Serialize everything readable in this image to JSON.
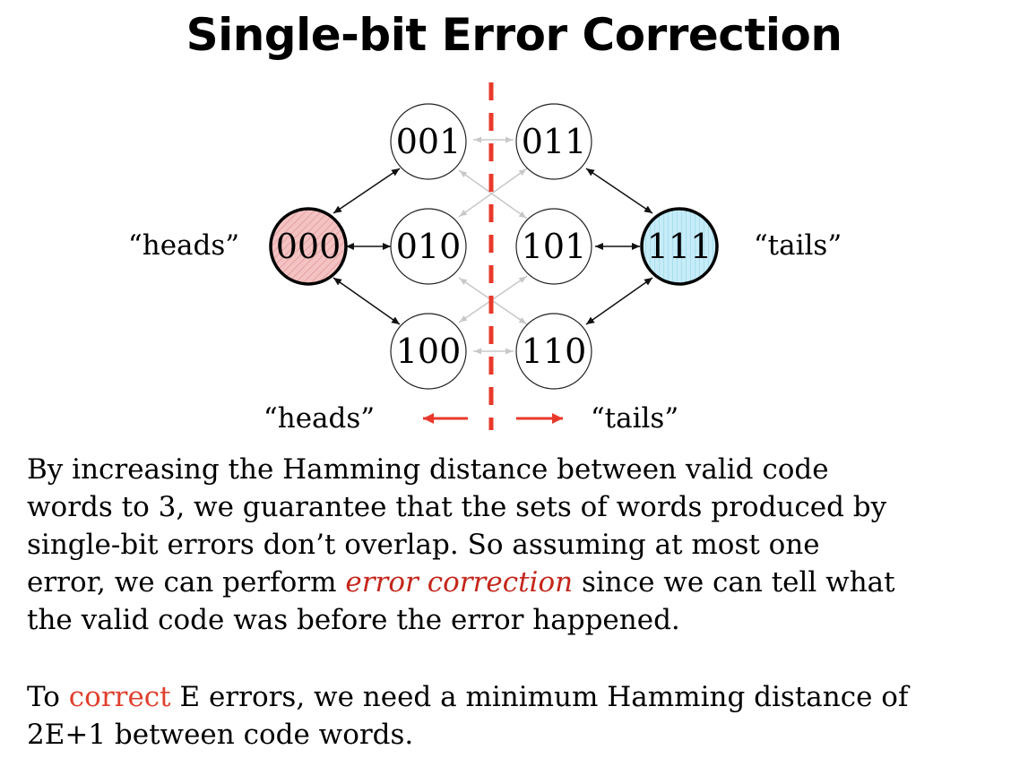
{
  "title": "Single-bit Error Correction",
  "nodes": [
    {
      "id": "n000",
      "label": "000",
      "style": "valid-heads"
    },
    {
      "id": "n001",
      "label": "001",
      "style": "normal"
    },
    {
      "id": "n010",
      "label": "010",
      "style": "normal"
    },
    {
      "id": "n100",
      "label": "100",
      "style": "normal"
    },
    {
      "id": "n011",
      "label": "011",
      "style": "normal"
    },
    {
      "id": "n101",
      "label": "101",
      "style": "normal"
    },
    {
      "id": "n110",
      "label": "110",
      "style": "normal"
    },
    {
      "id": "n111",
      "label": "111",
      "style": "valid-tails"
    }
  ],
  "labels": {
    "heads_left": "“heads”",
    "tails_right": "“tails”",
    "heads_bottom": "“heads”",
    "tails_bottom": "“tails”"
  },
  "paragraph1": {
    "line1": "By increasing the Hamming distance between valid code",
    "line2": "words to 3, we guarantee that the sets of words produced by",
    "line3": "single-bit errors don’t overlap.  So assuming at most one",
    "line4_pre": "error, we can perform ",
    "line4_emph": "error correction",
    "line4_post": " since we can tell what",
    "line5": "the valid code was before the error happened."
  },
  "paragraph2": {
    "line1_pre": "To ",
    "line1_emph": "correct",
    "line1_post": " E errors, we need a minimum Hamming distance of",
    "line2": "2E+1 between code words."
  },
  "colors": {
    "heads_fill": "#f2b8b8",
    "tails_fill": "#bfe8f5",
    "divider": "#e8392b",
    "faint_arrow": "#c8c8c8",
    "emphasis": "#c4261b"
  }
}
